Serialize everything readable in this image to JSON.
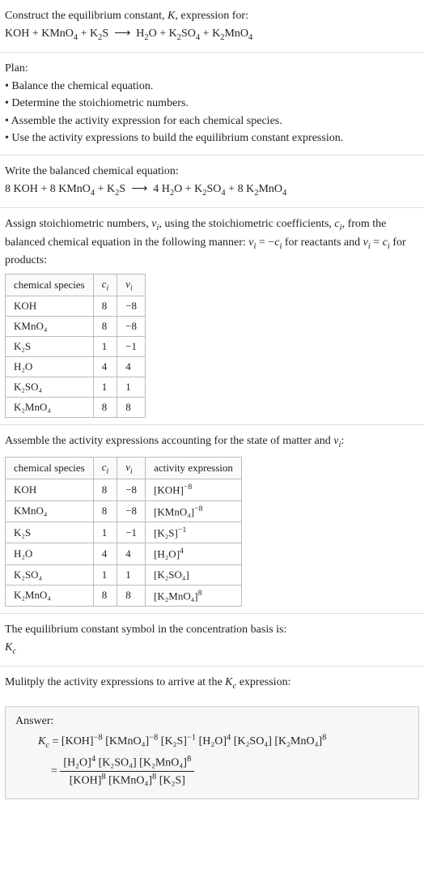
{
  "intro": {
    "construct": "Construct the equilibrium constant, K, expression for:",
    "equation_unbalanced": "KOH + KMnO₄ + K₂S ⟶ H₂O + K₂SO₄ + K₂MnO₄"
  },
  "plan": {
    "heading": "Plan:",
    "items": [
      "• Balance the chemical equation.",
      "• Determine the stoichiometric numbers.",
      "• Assemble the activity expression for each chemical species.",
      "• Use the activity expressions to build the equilibrium constant expression."
    ]
  },
  "balanced": {
    "heading": "Write the balanced chemical equation:",
    "equation": "8 KOH + 8 KMnO₄ + K₂S ⟶ 4 H₂O + K₂SO₄ + 8 K₂MnO₄"
  },
  "stoich": {
    "intro": "Assign stoichiometric numbers, νᵢ, using the stoichiometric coefficients, cᵢ, from the balanced chemical equation in the following manner: νᵢ = −cᵢ for reactants and νᵢ = cᵢ for products:",
    "headers": [
      "chemical species",
      "cᵢ",
      "νᵢ"
    ],
    "rows": [
      {
        "species": "KOH",
        "c": "8",
        "v": "−8"
      },
      {
        "species": "KMnO₄",
        "c": "8",
        "v": "−8"
      },
      {
        "species": "K₂S",
        "c": "1",
        "v": "−1"
      },
      {
        "species": "H₂O",
        "c": "4",
        "v": "4"
      },
      {
        "species": "K₂SO₄",
        "c": "1",
        "v": "1"
      },
      {
        "species": "K₂MnO₄",
        "c": "8",
        "v": "8"
      }
    ]
  },
  "activity": {
    "intro": "Assemble the activity expressions accounting for the state of matter and νᵢ:",
    "headers": [
      "chemical species",
      "cᵢ",
      "νᵢ",
      "activity expression"
    ],
    "rows": [
      {
        "species": "KOH",
        "c": "8",
        "v": "−8",
        "expr_base": "[KOH]",
        "expr_sup": "−8"
      },
      {
        "species": "KMnO₄",
        "c": "8",
        "v": "−8",
        "expr_base": "[KMnO₄]",
        "expr_sup": "−8"
      },
      {
        "species": "K₂S",
        "c": "1",
        "v": "−1",
        "expr_base": "[K₂S]",
        "expr_sup": "−1"
      },
      {
        "species": "H₂O",
        "c": "4",
        "v": "4",
        "expr_base": "[H₂O]",
        "expr_sup": "4"
      },
      {
        "species": "K₂SO₄",
        "c": "1",
        "v": "1",
        "expr_base": "[K₂SO₄]",
        "expr_sup": ""
      },
      {
        "species": "K₂MnO₄",
        "c": "8",
        "v": "8",
        "expr_base": "[K₂MnO₄]",
        "expr_sup": "8"
      }
    ]
  },
  "symbol": {
    "line1": "The equilibrium constant symbol in the concentration basis is:",
    "line2": "K꜀"
  },
  "multiply": {
    "heading": "Mulitply the activity expressions to arrive at the K꜀ expression:"
  },
  "answer": {
    "label": "Answer:",
    "kc": "K꜀ = ",
    "flat_terms": [
      {
        "base": "[KOH]",
        "sup": "−8"
      },
      {
        "base": " [KMnO₄]",
        "sup": "−8"
      },
      {
        "base": " [K₂S]",
        "sup": "−1"
      },
      {
        "base": " [H₂O]",
        "sup": "4"
      },
      {
        "base": " [K₂SO₄]",
        "sup": ""
      },
      {
        "base": " [K₂MnO₄]",
        "sup": "8"
      }
    ],
    "eq": " = ",
    "num_terms": [
      {
        "base": "[H₂O]",
        "sup": "4"
      },
      {
        "base": " [K₂SO₄]",
        "sup": ""
      },
      {
        "base": " [K₂MnO₄]",
        "sup": "8"
      }
    ],
    "den_terms": [
      {
        "base": "[KOH]",
        "sup": "8"
      },
      {
        "base": " [KMnO₄]",
        "sup": "8"
      },
      {
        "base": " [K₂S]",
        "sup": ""
      }
    ]
  }
}
